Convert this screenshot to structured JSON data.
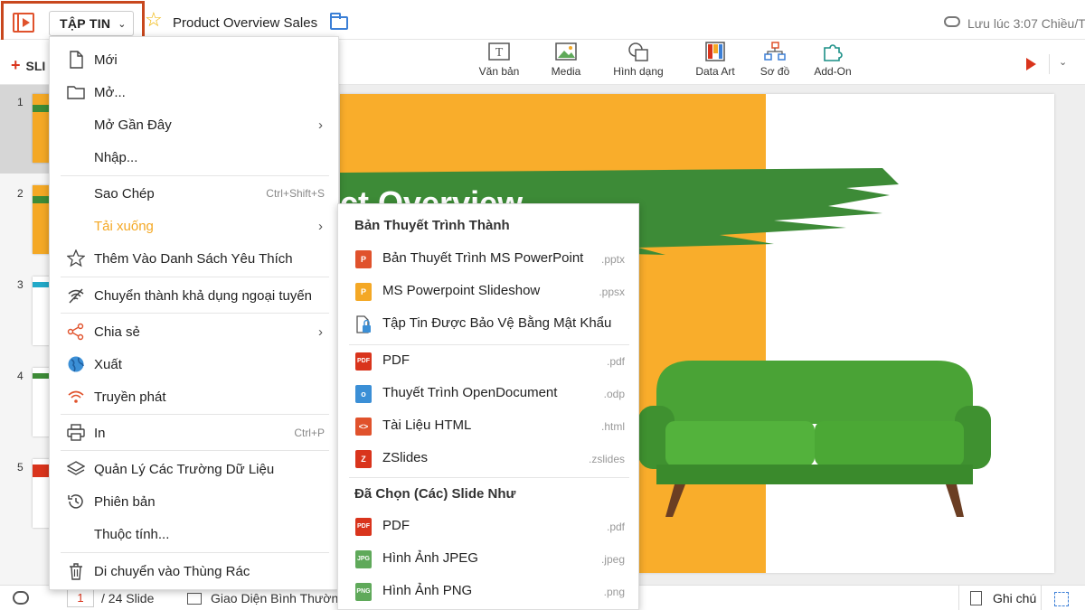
{
  "header": {
    "file_button": "TẬP TIN",
    "doc_title": "Product Overview Sales",
    "saved_status": "Lưu lúc 3:07 Chiều/T"
  },
  "toolbar": {
    "new_slide": "SLI",
    "tools": [
      {
        "label": "Văn bản",
        "icon": "text-box-icon"
      },
      {
        "label": "Media",
        "icon": "image-icon"
      },
      {
        "label": "Hình dạng",
        "icon": "shape-icon"
      },
      {
        "label": "Data Art",
        "icon": "data-art-icon"
      },
      {
        "label": "Sơ đồ",
        "icon": "diagram-icon"
      },
      {
        "label": "Add-On",
        "icon": "puzzle-icon"
      }
    ]
  },
  "slides_panel": {
    "numbers": [
      "1",
      "2",
      "3",
      "4",
      "5"
    ]
  },
  "slide": {
    "title_fragment": "ct Overview"
  },
  "file_menu": {
    "items": [
      {
        "label": "Mới",
        "icon": "new-doc-icon"
      },
      {
        "label": "Mở...",
        "icon": "folder-open-icon"
      },
      {
        "label": "Mở Gần Đây",
        "icon": "",
        "arrow": "›"
      },
      {
        "label": "Nhập...",
        "icon": ""
      },
      {
        "label": "Sao Chép",
        "icon": "",
        "shortcut": "Ctrl+Shift+S"
      },
      {
        "label": "Tải xuống",
        "icon": "",
        "arrow": "›"
      },
      {
        "label": "Thêm Vào Danh Sách Yêu Thích",
        "icon": "star-icon"
      },
      {
        "label": "Chuyển thành khả dụng ngoại tuyến",
        "icon": "offline-icon"
      },
      {
        "label": "Chia sẻ",
        "icon": "share-icon",
        "arrow": "›"
      },
      {
        "label": "Xuất",
        "icon": "globe-icon"
      },
      {
        "label": "Truyền phát",
        "icon": "broadcast-icon"
      },
      {
        "label": "In",
        "icon": "print-icon",
        "shortcut": "Ctrl+P"
      },
      {
        "label": "Quản Lý Các Trường Dữ Liệu",
        "icon": "layers-icon"
      },
      {
        "label": "Phiên bản",
        "icon": "history-icon"
      },
      {
        "label": "Thuộc tính...",
        "icon": ""
      },
      {
        "label": "Di chuyển vào Thùng Rác",
        "icon": "trash-icon"
      }
    ]
  },
  "download_menu": {
    "section1_title": "Bản Thuyết Trình Thành",
    "section1_items": [
      {
        "label": "Bản Thuyết Trình MS PowerPoint",
        "ext": ".pptx",
        "badge": "P",
        "color": "#e0522c"
      },
      {
        "label": "MS Powerpoint Slideshow",
        "ext": ".ppsx",
        "badge": "P",
        "color": "#f4a825"
      },
      {
        "label": "Tập Tin Được Bảo Vệ Bằng Mật Khẩu",
        "ext": "",
        "badge": "",
        "color": "#777777"
      }
    ],
    "section2_items": [
      {
        "label": "PDF",
        "ext": ".pdf",
        "badge": "PDF",
        "color": "#d9341c"
      },
      {
        "label": "Thuyết Trình OpenDocument",
        "ext": ".odp",
        "badge": "o",
        "color": "#3b8fd6"
      },
      {
        "label": "Tài Liệu HTML",
        "ext": ".html",
        "badge": "<>",
        "color": "#e0522c"
      },
      {
        "label": "ZSlides",
        "ext": ".zslides",
        "badge": "Z",
        "color": "#d9341c"
      }
    ],
    "section3_title": "Đã Chọn (Các) Slide Như",
    "section3_items": [
      {
        "label": "PDF",
        "ext": ".pdf",
        "badge": "PDF",
        "color": "#d9341c"
      },
      {
        "label": "Hình Ảnh JPEG",
        "ext": ".jpeg",
        "badge": "JPG",
        "color": "#5fa95a"
      },
      {
        "label": "Hình Ảnh PNG",
        "ext": ".png",
        "badge": "PNG",
        "color": "#5fa95a"
      }
    ]
  },
  "statusbar": {
    "page_current": "1",
    "page_total": "/ 24 Slide",
    "view_label": "Giao Diện Bình Thường",
    "notes_label": "Ghi chú"
  },
  "colors": {
    "accent": "#c8471d",
    "highlight_text": "#f4a825",
    "slide_orange": "#f9ad2b",
    "slide_green": "#3d8b37"
  }
}
